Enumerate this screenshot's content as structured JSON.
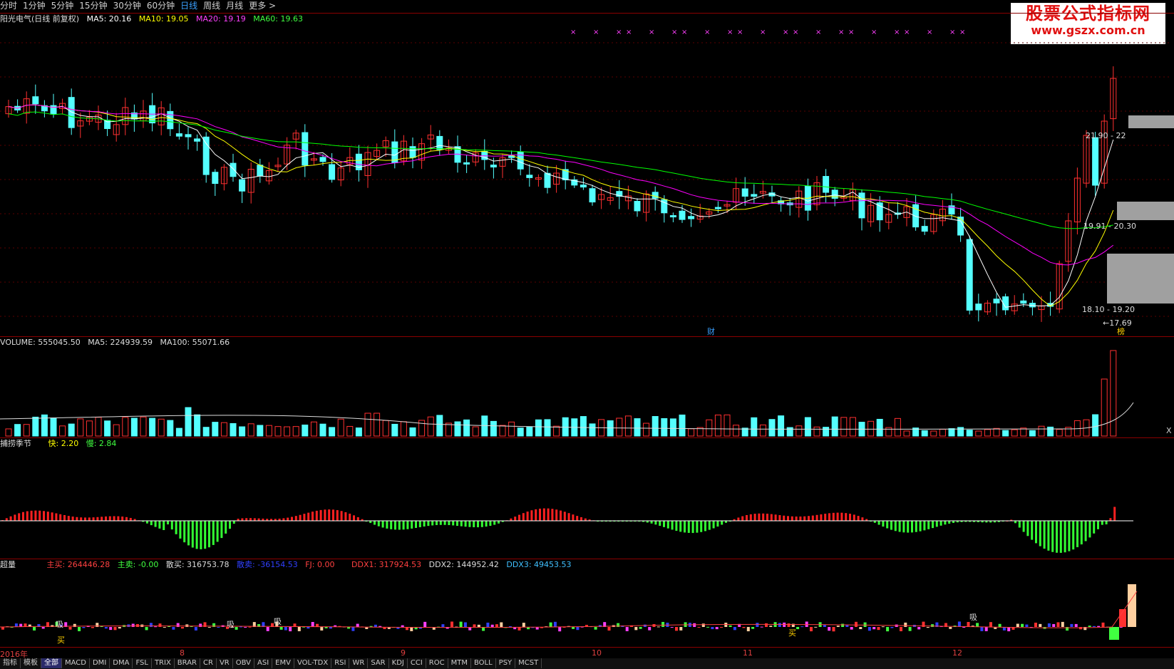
{
  "tabs": [
    "分时",
    "1分钟",
    "5分钟",
    "15分钟",
    "30分钟",
    "60分钟",
    "日线",
    "周线",
    "月线",
    "更多 >"
  ],
  "active_tab": "日线",
  "price_panel": {
    "title": "阳光电气(日线 前复权)",
    "ma5": "MA5: 20.16",
    "ma10": "MA10: 19.05",
    "ma20": "MA20: 19.19",
    "ma60": "MA60: 19.63",
    "range_labels": [
      "21.90 - 22",
      "19.91 - 20.30",
      "18.10 - 19.20"
    ],
    "low_label": "←17.69",
    "marker_cai": "财",
    "marker_bang": "榜"
  },
  "watermark": {
    "line1": "股票公式指标网",
    "line2": "www.gszx.com.cn"
  },
  "volume_panel": {
    "title": "VOLUME: 555045.50",
    "ma5": "MA5: 224939.59",
    "ma100": "MA100: 55071.66",
    "right_label": "X"
  },
  "season_panel": {
    "title": "捕捞季节",
    "fast": "快: 2.20",
    "slow": "慢: 2.84"
  },
  "ddx_panel": {
    "title": "超量",
    "zhumai": "主买: 264446.28",
    "zhumai2": "主卖: -0.00",
    "sanmai": "散买: 316753.78",
    "sanmai2": "散卖: -36154.53",
    "fj": "FJ: 0.00",
    "ddx1": "DDX1: 317924.53",
    "ddx2": "DDX2: 144952.42",
    "ddx3": "DDX3: 49453.53",
    "marks": [
      "吸",
      "吸",
      "吸",
      "吸",
      "买",
      "买"
    ]
  },
  "x_axis": [
    "2016年",
    "8",
    "9",
    "10",
    "11",
    "12"
  ],
  "bottom_tabs": [
    "指标",
    "模板",
    "全部",
    "MACD",
    "DMI",
    "DMA",
    "FSL",
    "TRIX",
    "BRAR",
    "CR",
    "VR",
    "OBV",
    "ASI",
    "EMV",
    "VOL-TDX",
    "RSI",
    "WR",
    "SAR",
    "KDJ",
    "CCI",
    "ROC",
    "MTM",
    "BOLL",
    "PSY",
    "MCST"
  ],
  "active_bottom_tab": "全部",
  "colors": {
    "up": "#ff3030",
    "down": "#54ffff",
    "ma5": "#ffffff",
    "ma10": "#ffff00",
    "ma20": "#ff00ff",
    "ma60": "#00ff00",
    "divider": "#8b0000",
    "accent": "#3aa0ff",
    "bar_green": "#33ff33",
    "bar_red": "#ff2020"
  }
}
